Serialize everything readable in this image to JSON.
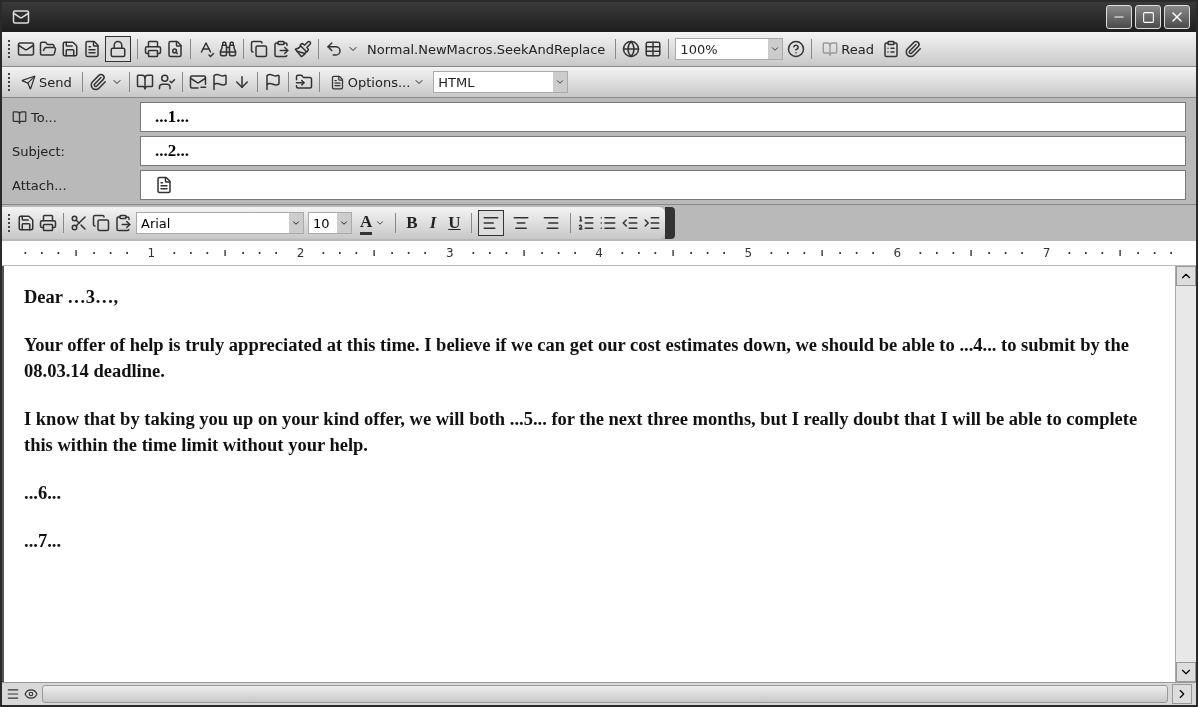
{
  "standard_toolbar": {
    "layout_button_selected": true,
    "macro_label": "Normal.NewMacros.SeekAndReplace",
    "zoom": "100%",
    "read_label": "Read"
  },
  "email_toolbar": {
    "send_label": "Send",
    "options_label": "Options...",
    "format": "HTML"
  },
  "fields": [
    {
      "kind": "address",
      "label": "To...",
      "value": "...1..."
    },
    {
      "kind": "text",
      "label": "Subject:",
      "value": "...2..."
    },
    {
      "kind": "attachment",
      "label": "Attach..."
    }
  ],
  "formatting_toolbar": {
    "font": "Arial",
    "size": "10",
    "font_color_label": "A",
    "style_buttons": [
      "B",
      "I",
      "U"
    ],
    "align_buttons": [
      {
        "kind": "left",
        "selected": true
      },
      {
        "kind": "center",
        "selected": false
      },
      {
        "kind": "right",
        "selected": false
      }
    ]
  },
  "ruler": {
    "numbers": [
      "1",
      "2",
      "3",
      "4",
      "5",
      "6",
      "7"
    ]
  },
  "body": {
    "paragraphs": [
      "Dear …3…,",
      "Your offer of help is truly appreciated at this time. I believe if we can get our cost estimates down, we should be able to ...4... to submit by the 08.03.14 deadline.",
      "I know that by taking you up on your kind offer, we will both ...5... for the next three months, but I really doubt that I will be able to complete this within the time limit without your help.",
      "...6...",
      "...7..."
    ]
  }
}
